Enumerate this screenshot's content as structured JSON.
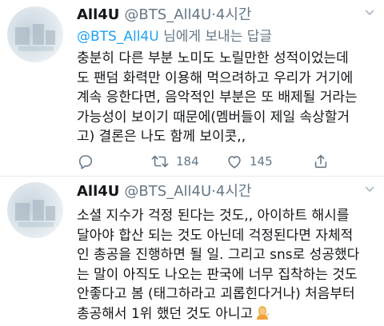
{
  "tweets": [
    {
      "display_name": "All4U",
      "handle": "@BTS_All4U",
      "separator": "·",
      "time": "4시간",
      "reply_handle": "@BTS_All4U",
      "reply_text": "님에게 보내는 답글",
      "lines": [
        "충분히 다른 부분 노미도 노릴만한 성적이었는데",
        "도 팬덤 화력만 이용해 먹으려하고 우리가 거기에",
        "계속 응한다면, 음악적인 부분은 또 배제될 거라는",
        "가능성이 보이기 때문에(멤버들이 제일 속상할거",
        "고) 결론은 나도 함께 보이콧,,"
      ],
      "retweets": "184",
      "likes": "145"
    },
    {
      "display_name": "All4U",
      "handle": "@BTS_All4U",
      "separator": "·",
      "time": "4시간",
      "lines": [
        "소셜 지수가 걱정 된다는 것도,, 아이하트 해시를",
        "달아야 합산 되는 것도 아닌데 걱정된다면 자체적",
        "인 총공을 진행하면 될 일. 그리고 sns로 성공했다",
        "는 말이 아직도 나오는 판국에 너무 집착하는 것도",
        "안좋다고 봄 (태그하라고 괴롭힌다거나) 처음부터",
        "총공해서 1위 했던 것도 아니고"
      ]
    }
  ],
  "icons": {
    "reply": "reply-icon",
    "retweet": "retweet-icon",
    "like": "heart-icon",
    "share": "share-icon",
    "chevron": "chevron-down-icon",
    "emoji": "person-tipping-hand-emoji"
  },
  "colors": {
    "link": "#1da1f2",
    "muted": "#657786",
    "text": "#14171a",
    "divider": "#e6ecf0"
  }
}
